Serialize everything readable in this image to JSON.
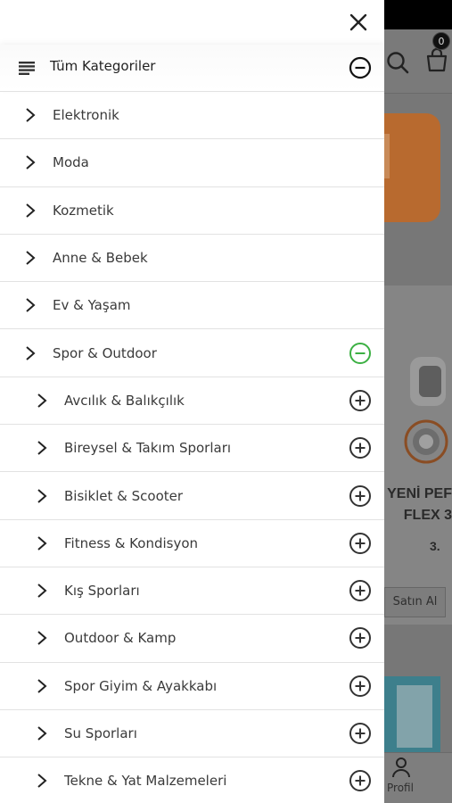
{
  "background": {
    "cart_count": "0",
    "product_title_line1": "YENİ PEF",
    "product_title_line2": "FLEX 3",
    "product_price": "3.",
    "buy_button": "Satın Al",
    "nav_profile": "Profil"
  },
  "drawer": {
    "all_categories_label": "Tüm Kategoriler",
    "accent_color": "#3cb043",
    "categories": [
      {
        "label": "Elektronik"
      },
      {
        "label": "Moda"
      },
      {
        "label": "Kozmetik"
      },
      {
        "label": "Anne & Bebek"
      },
      {
        "label": "Ev & Yaşam"
      },
      {
        "label": "Spor & Outdoor",
        "expanded": true
      }
    ],
    "subcategories": [
      {
        "label": "Avcılık & Balıkçılık"
      },
      {
        "label": "Bireysel & Takım Sporları"
      },
      {
        "label": "Bisiklet & Scooter"
      },
      {
        "label": "Fitness & Kondisyon"
      },
      {
        "label": "Kış Sporları"
      },
      {
        "label": "Outdoor & Kamp"
      },
      {
        "label": "Spor Giyim & Ayakkabı"
      },
      {
        "label": "Su Sporları"
      },
      {
        "label": "Tekne & Yat Malzemeleri"
      }
    ]
  }
}
